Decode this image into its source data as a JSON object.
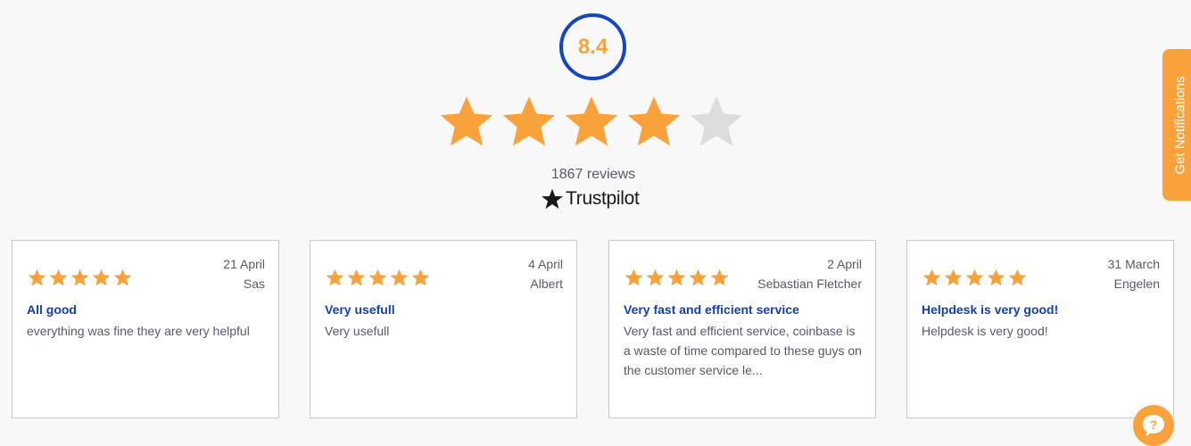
{
  "rating": {
    "score": "8.4",
    "stars_filled": 4,
    "stars_total": 5,
    "reviews_label": "1867 reviews",
    "brand": "Trustpilot"
  },
  "colors": {
    "star_filled": "#f9a23b",
    "star_empty": "#dcdcdc",
    "circle_border": "#1546c0",
    "title_blue": "#1140b8"
  },
  "reviews": [
    {
      "stars": 5,
      "date": "21 April",
      "author": "Sas",
      "title": "All good",
      "body": "everything was fine they are very helpful"
    },
    {
      "stars": 5,
      "date": "4 April",
      "author": "Albert",
      "title": "Very usefull",
      "body": "Very usefull"
    },
    {
      "stars": 5,
      "date": "2 April",
      "author": "Sebastian Fletcher",
      "title": "Very fast and efficient service",
      "body": "Very fast and efficient service, coinbase is a waste of time compared to these guys on the customer service le..."
    },
    {
      "stars": 5,
      "date": "31 March",
      "author": "Engelen",
      "title": "Helpdesk is very good!",
      "body": "Helpdesk is very good!"
    }
  ],
  "notifications": {
    "label": "Get Notifications"
  },
  "help": {
    "icon": "question-mark-icon"
  }
}
